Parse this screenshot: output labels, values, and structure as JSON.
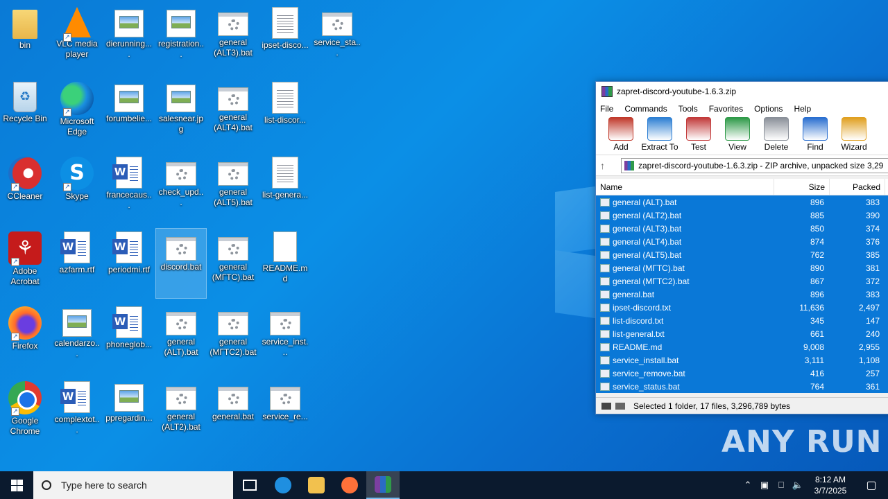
{
  "desktop": {
    "icons": [
      {
        "label": "bin",
        "kind": "folder",
        "col": 0,
        "row": 0
      },
      {
        "label": "VLC media player",
        "kind": "vlc",
        "col": 1,
        "row": 0,
        "shortcut": true
      },
      {
        "label": "dierunning....",
        "kind": "img",
        "col": 2,
        "row": 0
      },
      {
        "label": "registration...",
        "kind": "img",
        "col": 3,
        "row": 0
      },
      {
        "label": "general (ALT3).bat",
        "kind": "bat",
        "col": 4,
        "row": 0
      },
      {
        "label": "ipset-disco...",
        "kind": "doc",
        "col": 5,
        "row": 0
      },
      {
        "label": "service_sta...",
        "kind": "bat",
        "col": 6,
        "row": 0
      },
      {
        "label": "Recycle Bin",
        "kind": "bin",
        "col": 0,
        "row": 1
      },
      {
        "label": "Microsoft Edge",
        "kind": "edge",
        "col": 1,
        "row": 1,
        "shortcut": true
      },
      {
        "label": "forumbelie...",
        "kind": "img",
        "col": 2,
        "row": 1
      },
      {
        "label": "salesnear.jpg",
        "kind": "img",
        "col": 3,
        "row": 1
      },
      {
        "label": "general (ALT4).bat",
        "kind": "bat",
        "col": 4,
        "row": 1
      },
      {
        "label": "list-discor...",
        "kind": "doc",
        "col": 5,
        "row": 1
      },
      {
        "label": "CCleaner",
        "kind": "ccleaner",
        "col": 0,
        "row": 2,
        "shortcut": true
      },
      {
        "label": "Skype",
        "kind": "skype",
        "col": 1,
        "row": 2,
        "shortcut": true
      },
      {
        "label": "francecaus...",
        "kind": "word",
        "col": 2,
        "row": 2
      },
      {
        "label": "check_upd...",
        "kind": "bat",
        "col": 3,
        "row": 2
      },
      {
        "label": "general (ALT5).bat",
        "kind": "bat",
        "col": 4,
        "row": 2
      },
      {
        "label": "list-genera...",
        "kind": "doc",
        "col": 5,
        "row": 2
      },
      {
        "label": "Adobe Acrobat",
        "kind": "acrobat",
        "col": 0,
        "row": 3,
        "shortcut": true
      },
      {
        "label": "azfarm.rtf",
        "kind": "word",
        "col": 1,
        "row": 3
      },
      {
        "label": "periodmi.rtf",
        "kind": "word",
        "col": 2,
        "row": 3
      },
      {
        "label": "discord.bat",
        "kind": "bat",
        "col": 3,
        "row": 3,
        "selected": true
      },
      {
        "label": "general (МГТС).bat",
        "kind": "bat",
        "col": 4,
        "row": 3
      },
      {
        "label": "README.md",
        "kind": "plain",
        "col": 5,
        "row": 3
      },
      {
        "label": "Firefox",
        "kind": "firefox",
        "col": 0,
        "row": 4,
        "shortcut": true
      },
      {
        "label": "calendarzo...",
        "kind": "img",
        "col": 1,
        "row": 4
      },
      {
        "label": "phoneglob...",
        "kind": "word",
        "col": 2,
        "row": 4
      },
      {
        "label": "general (ALT).bat",
        "kind": "bat",
        "col": 3,
        "row": 4
      },
      {
        "label": "general (МГТС2).bat",
        "kind": "bat",
        "col": 4,
        "row": 4
      },
      {
        "label": "service_inst...",
        "kind": "bat",
        "col": 5,
        "row": 4
      },
      {
        "label": "Google Chrome",
        "kind": "chrome",
        "col": 0,
        "row": 5,
        "shortcut": true
      },
      {
        "label": "complextot...",
        "kind": "word",
        "col": 1,
        "row": 5
      },
      {
        "label": "ppregardin...",
        "kind": "img",
        "col": 2,
        "row": 5
      },
      {
        "label": "general (ALT2).bat",
        "kind": "bat",
        "col": 3,
        "row": 5
      },
      {
        "label": "general.bat",
        "kind": "bat",
        "col": 4,
        "row": 5
      },
      {
        "label": "service_re...",
        "kind": "bat",
        "col": 5,
        "row": 5
      }
    ]
  },
  "winrar": {
    "title": "zapret-discord-youtube-1.6.3.zip",
    "menu": [
      "File",
      "Commands",
      "Tools",
      "Favorites",
      "Options",
      "Help"
    ],
    "toolbar": [
      {
        "label": "Add",
        "icon": "add-icon",
        "color": "#c0392b"
      },
      {
        "label": "Extract To",
        "icon": "extract-folder-icon",
        "color": "#2d7fd3"
      },
      {
        "label": "Test",
        "icon": "test-clipboard-icon",
        "color": "#c23a3a"
      },
      {
        "label": "View",
        "icon": "view-book-icon",
        "color": "#2e9a48"
      },
      {
        "label": "Delete",
        "icon": "delete-trash-icon",
        "color": "#8a9099"
      },
      {
        "label": "Find",
        "icon": "find-magnifier-icon",
        "color": "#2a6fd0"
      },
      {
        "label": "Wizard",
        "icon": "wizard-wand-icon",
        "color": "#e0a020"
      }
    ],
    "path": "zapret-discord-youtube-1.6.3.zip - ZIP archive, unpacked size 3,29",
    "columns": {
      "name": "Name",
      "size": "Size",
      "packed": "Packed"
    },
    "files": [
      {
        "name": "general (ALT).bat",
        "size": "896",
        "packed": "383"
      },
      {
        "name": "general (ALT2).bat",
        "size": "885",
        "packed": "390"
      },
      {
        "name": "general (ALT3).bat",
        "size": "850",
        "packed": "374"
      },
      {
        "name": "general (ALT4).bat",
        "size": "874",
        "packed": "376"
      },
      {
        "name": "general (ALT5).bat",
        "size": "762",
        "packed": "385"
      },
      {
        "name": "general (МГТС).bat",
        "size": "890",
        "packed": "381"
      },
      {
        "name": "general (МГТС2).bat",
        "size": "867",
        "packed": "372"
      },
      {
        "name": "general.bat",
        "size": "896",
        "packed": "383"
      },
      {
        "name": "ipset-discord.txt",
        "size": "11,636",
        "packed": "2,497"
      },
      {
        "name": "list-discord.txt",
        "size": "345",
        "packed": "147"
      },
      {
        "name": "list-general.txt",
        "size": "661",
        "packed": "240"
      },
      {
        "name": "README.md",
        "size": "9,008",
        "packed": "2,955"
      },
      {
        "name": "service_install.bat",
        "size": "3,111",
        "packed": "1,108"
      },
      {
        "name": "service_remove.bat",
        "size": "416",
        "packed": "257"
      },
      {
        "name": "service_status.bat",
        "size": "764",
        "packed": "361"
      }
    ],
    "status": "Selected 1 folder, 17 files, 3,296,789 bytes"
  },
  "watermark": "ANY RUN",
  "taskbar": {
    "search_placeholder": "Type here to search",
    "apps": [
      {
        "name": "task-view",
        "color": "#ffffff"
      },
      {
        "name": "edge",
        "color": "#1f8fe0"
      },
      {
        "name": "file-explorer",
        "color": "#f2c14e"
      },
      {
        "name": "firefox",
        "color": "#ff7139"
      },
      {
        "name": "winrar",
        "color": "#7b3fa0",
        "active": true
      }
    ],
    "time": "8:12 AM",
    "date": "3/7/2025"
  }
}
